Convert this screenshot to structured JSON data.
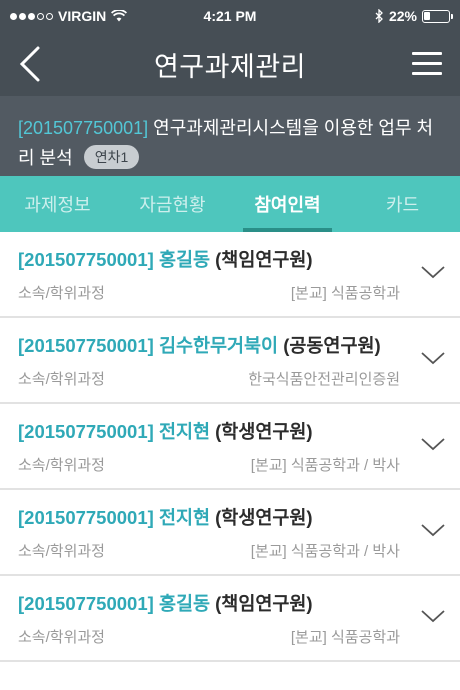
{
  "status_bar": {
    "carrier": "VIRGIN",
    "time": "4:21 PM",
    "battery_percent": "22%",
    "battery_level": 0.22,
    "icons": [
      "signal-dots-icon",
      "wifi-icon",
      "bluetooth-icon",
      "battery-icon"
    ]
  },
  "nav": {
    "title": "연구과제관리",
    "back_icon": "back-chevron-icon",
    "menu_icon": "hamburger-menu-icon"
  },
  "project": {
    "id": "[201507750001]",
    "title": "연구과제관리시스템을 이용한 업무 처리 분석",
    "badge": "연차1"
  },
  "tabs": [
    {
      "label": "과제정보",
      "active": false
    },
    {
      "label": "자금현황",
      "active": false
    },
    {
      "label": "참여인력",
      "active": true
    },
    {
      "label": "카드",
      "active": false
    }
  ],
  "members": [
    {
      "id": "[201507750001]",
      "name": "홍길동",
      "role": "(책임연구원)",
      "affiliation_label": "소속/학위과정",
      "affiliation": "[본교] 식품공학과"
    },
    {
      "id": "[201507750001]",
      "name": "김수한무거북이",
      "role": "(공동연구원)",
      "affiliation_label": "소속/학위과정",
      "affiliation": "한국식품안전관리인증원"
    },
    {
      "id": "[201507750001]",
      "name": "전지현",
      "role": "(학생연구원)",
      "affiliation_label": "소속/학위과정",
      "affiliation": "[본교] 식품공학과 / 박사"
    },
    {
      "id": "[201507750001]",
      "name": "전지현",
      "role": "(학생연구원)",
      "affiliation_label": "소속/학위과정",
      "affiliation": "[본교] 식품공학과 / 박사"
    },
    {
      "id": "[201507750001]",
      "name": "홍길동",
      "role": "(책임연구원)",
      "affiliation_label": "소속/학위과정",
      "affiliation": "[본교] 식품공학과"
    }
  ],
  "colors": {
    "header_bg": "#464e55",
    "project_bg": "#525a62",
    "tab_bg": "#4ec6bd",
    "accent": "#2fa9b7"
  }
}
